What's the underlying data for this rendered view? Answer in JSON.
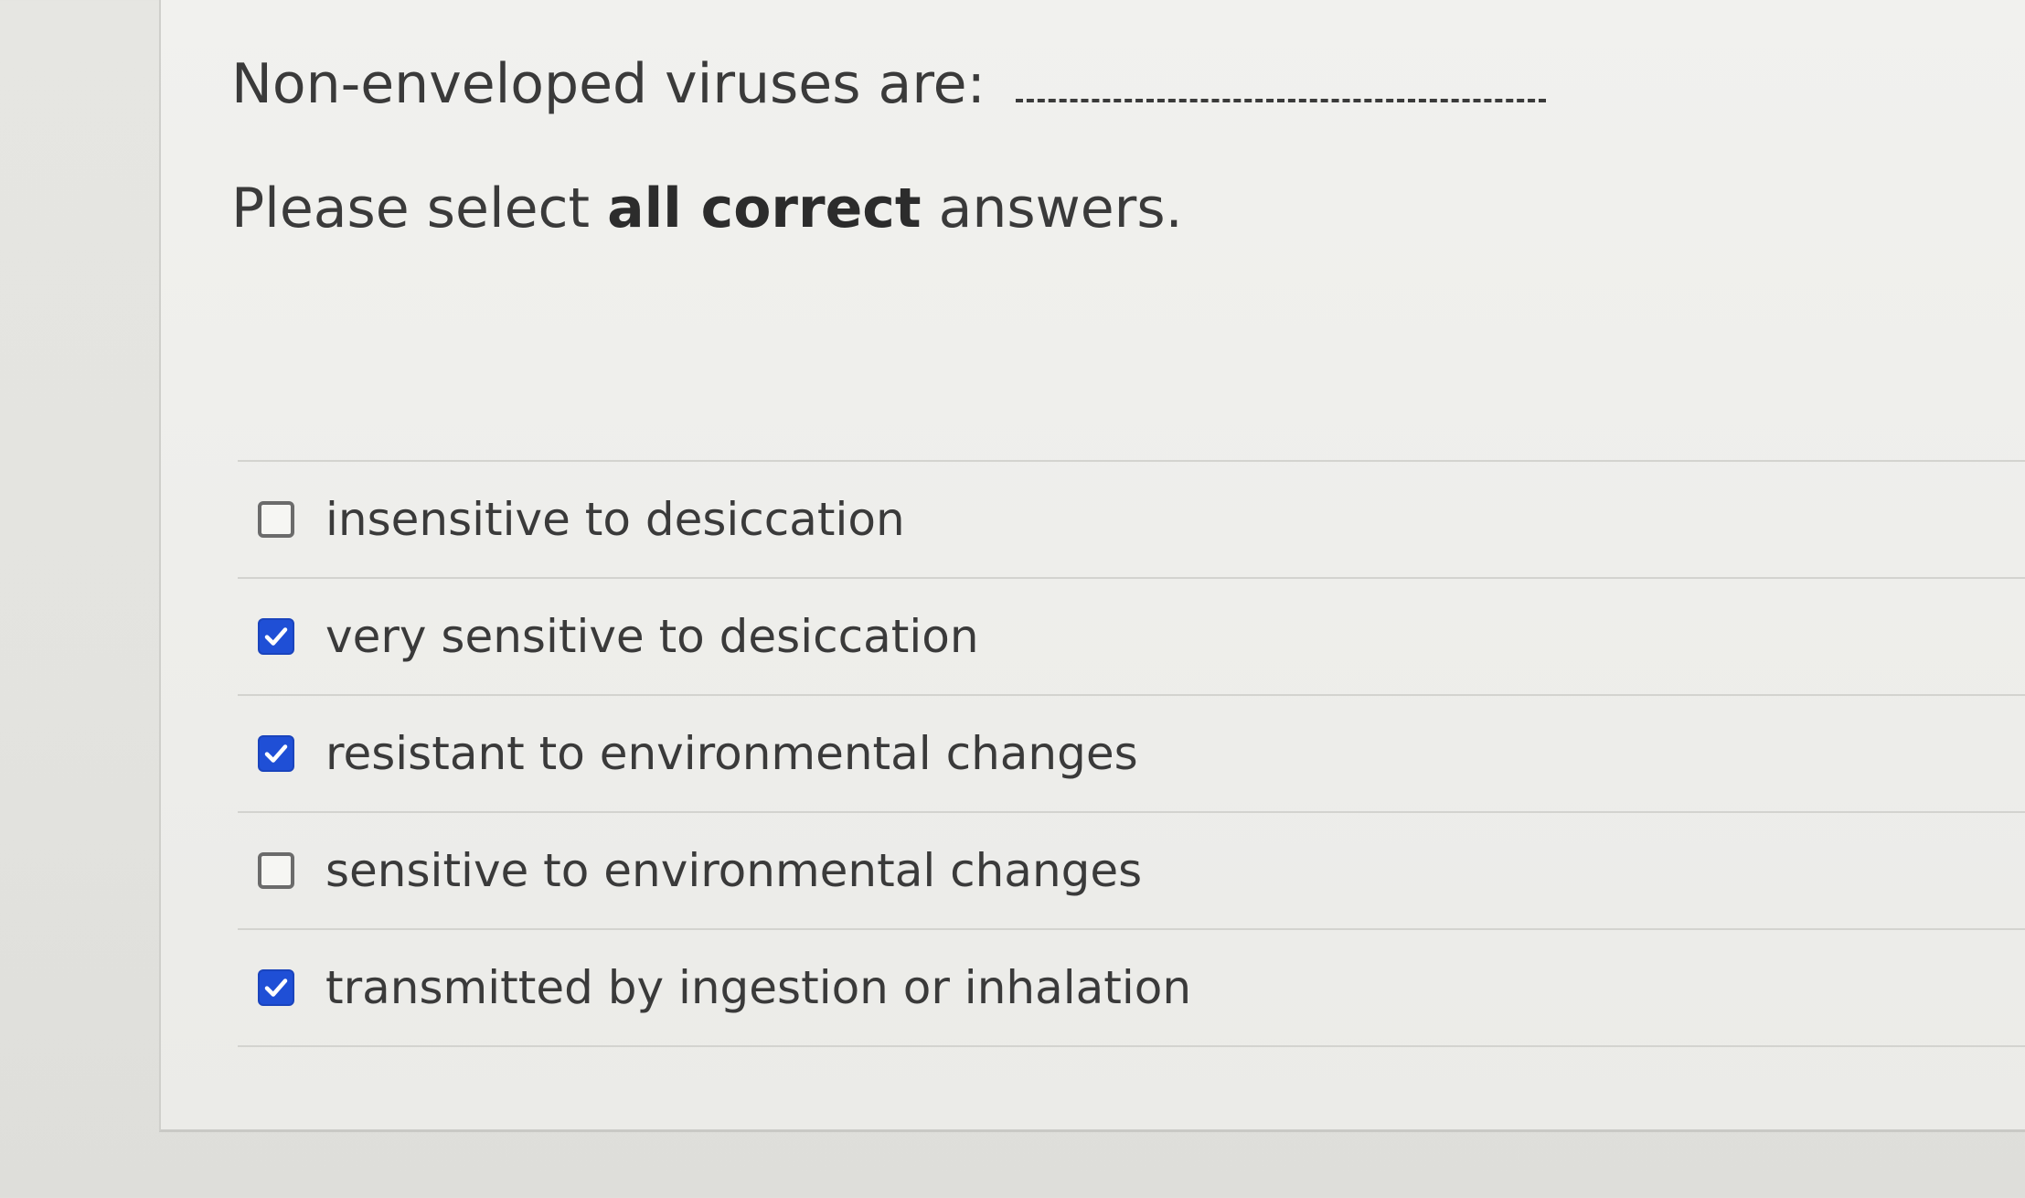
{
  "question": {
    "prompt": "Non-enveloped viruses are:",
    "instruction_prefix": "Please select ",
    "instruction_emphasis": "all correct",
    "instruction_suffix": " answers."
  },
  "options": [
    {
      "label": "insensitive to desiccation",
      "checked": false
    },
    {
      "label": "very sensitive to desiccation",
      "checked": true
    },
    {
      "label": "resistant to environmental changes",
      "checked": true
    },
    {
      "label": "sensitive to environmental changes",
      "checked": false
    },
    {
      "label": "transmitted by ingestion or inhalation",
      "checked": true
    }
  ],
  "colors": {
    "checkbox_checked": "#1f4fd6",
    "text": "#3a3a3a"
  },
  "icons": {
    "checked": "checkmark-icon"
  }
}
